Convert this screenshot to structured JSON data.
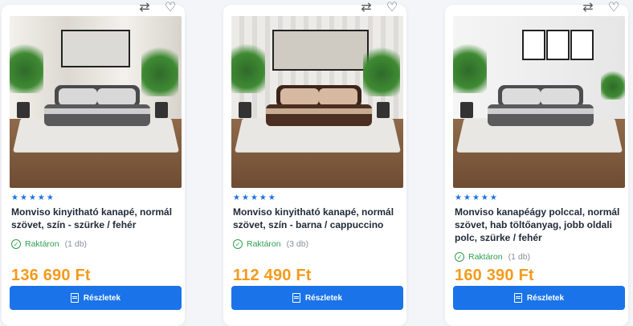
{
  "products": [
    {
      "title": "Monviso kinyitható kanapé, normál szövet, szín - szürke / fehér",
      "stock_label": "Raktáron",
      "stock_qty": "(1 db)",
      "price": "136 690 Ft",
      "button": "Részletek",
      "stars": [
        "★",
        "★",
        "★",
        "★",
        "★"
      ],
      "colors": {
        "wall": "#e8e4de",
        "sofa_base": "#5a5a5c",
        "sofa_back": "#4a4a4c",
        "cushion": "#d8d8d8"
      }
    },
    {
      "title": "Monviso kinyitható kanapé, normál szövet, szín - barna / cappuccino",
      "stock_label": "Raktáron",
      "stock_qty": "(3 db)",
      "price": "112 490 Ft",
      "button": "Részletek",
      "stars": [
        "★",
        "★",
        "★",
        "★",
        "★"
      ],
      "colors": {
        "wall": "#e6e4e0",
        "sofa_base": "#4a2f22",
        "sofa_back": "#3b251b",
        "cushion": "#d6b9a0"
      }
    },
    {
      "title": "Monviso kanapéágy polccal, normál szövet, hab töltőanyag, jobb oldali polc, szürke / fehér",
      "stock_label": "Raktáron",
      "stock_qty": "(1 db)",
      "price": "160 390 Ft",
      "button": "Részletek",
      "stars": [
        "★",
        "★",
        "★",
        "★",
        "★"
      ],
      "colors": {
        "wall": "#efefef",
        "sofa_base": "#5b5b5d",
        "sofa_back": "#4d4d4f",
        "cushion": "#dcdcdc"
      }
    }
  ],
  "icons": {
    "compare": "compare-arrows-icon",
    "wishlist": "heart-icon",
    "stock": "check-circle-icon",
    "details": "document-icon",
    "rating": "star-icon"
  }
}
